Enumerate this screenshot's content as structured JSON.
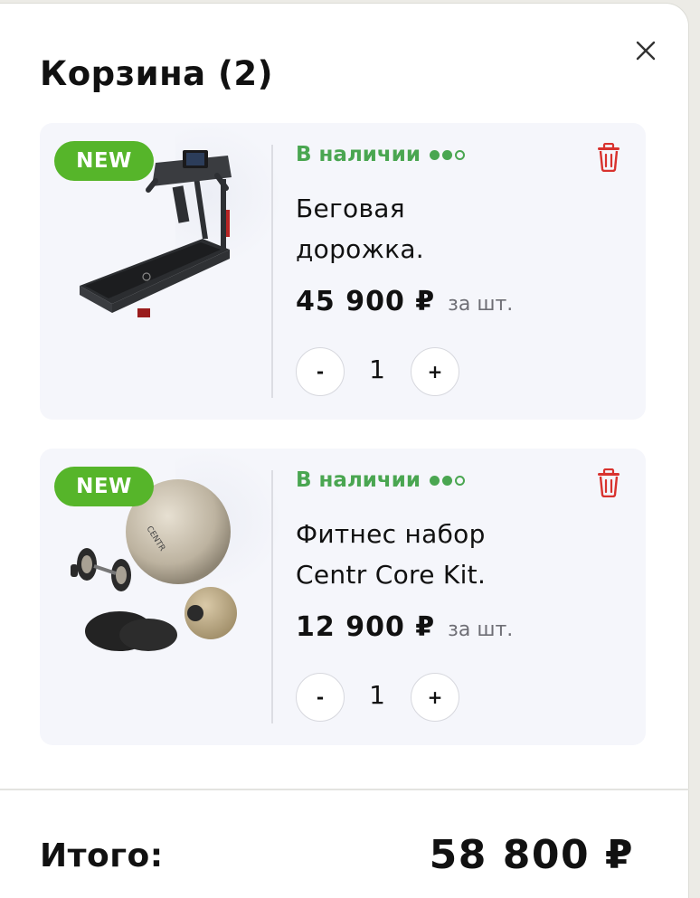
{
  "cart": {
    "title": "Корзина (2)",
    "close_icon": "close-icon",
    "items": [
      {
        "badge": "NEW",
        "stock": "В наличии",
        "stock_level": 2,
        "stock_max": 3,
        "name_line1": "Беговая",
        "name_line2": "дорожка.",
        "price": "45 900 ₽",
        "per_unit": "за шт.",
        "qty_minus": "-",
        "qty": "1",
        "qty_plus": "+",
        "image_icon": "treadmill-image",
        "delete_icon": "trash-icon"
      },
      {
        "badge": "NEW",
        "stock": "В наличии",
        "stock_level": 2,
        "stock_max": 3,
        "name_line1": "Фитнес набор",
        "name_line2": "Centr Core Kit.",
        "price": "12 900 ₽",
        "per_unit": "за шт.",
        "qty_minus": "-",
        "qty": "1",
        "qty_plus": "+",
        "image_icon": "fitness-kit-image",
        "delete_icon": "trash-icon"
      }
    ],
    "total_label": "Итого:",
    "total_value": "58 800 ₽"
  },
  "colors": {
    "badge": "#56b52a",
    "stock": "#4aa651",
    "trash": "#d8322e",
    "card_bg": "#f5f6fb"
  }
}
